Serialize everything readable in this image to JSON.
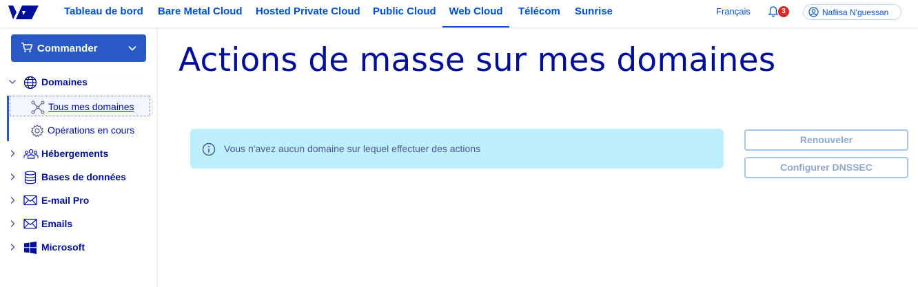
{
  "topnav": {
    "tabs": [
      {
        "label": "Tableau de bord"
      },
      {
        "label": "Bare Metal Cloud"
      },
      {
        "label": "Hosted Private Cloud"
      },
      {
        "label": "Public Cloud"
      },
      {
        "label": "Web Cloud"
      },
      {
        "label": "Télécom"
      },
      {
        "label": "Sunrise"
      }
    ],
    "active_tab": "Web Cloud",
    "language": "Français",
    "notifications_count": "3",
    "user_name": "Nafiisa N'guessan"
  },
  "sidebar": {
    "order_button": "Commander",
    "items": [
      {
        "label": "Domaines",
        "icon": "globe-icon",
        "expanded": true
      },
      {
        "label": "Hébergements",
        "icon": "users-icon",
        "expanded": false
      },
      {
        "label": "Bases de données",
        "icon": "database-icon",
        "expanded": false
      },
      {
        "label": "E-mail Pro",
        "icon": "envelope-icon",
        "expanded": false
      },
      {
        "label": "Emails",
        "icon": "envelope-icon",
        "expanded": false
      },
      {
        "label": "Microsoft",
        "icon": "windows-icon",
        "expanded": false
      }
    ],
    "subitems": [
      {
        "label": "Tous mes domaines",
        "icon": "network-icon",
        "active": true
      },
      {
        "label": "Opérations en cours",
        "icon": "gear-icon",
        "active": false
      }
    ]
  },
  "main": {
    "title": "Actions de masse sur mes domaines",
    "info_message": "Vous n'avez aucun domaine sur lequel effectuer des actions",
    "actions": [
      {
        "label": "Renouveler",
        "disabled": true
      },
      {
        "label": "Configurer DNSSEC",
        "disabled": true
      }
    ]
  },
  "colors": {
    "brand": "#000e9c",
    "link": "#0050d7",
    "primary_button": "#2859c5",
    "info_bg": "#bdeffd",
    "badge": "#d62b26"
  }
}
